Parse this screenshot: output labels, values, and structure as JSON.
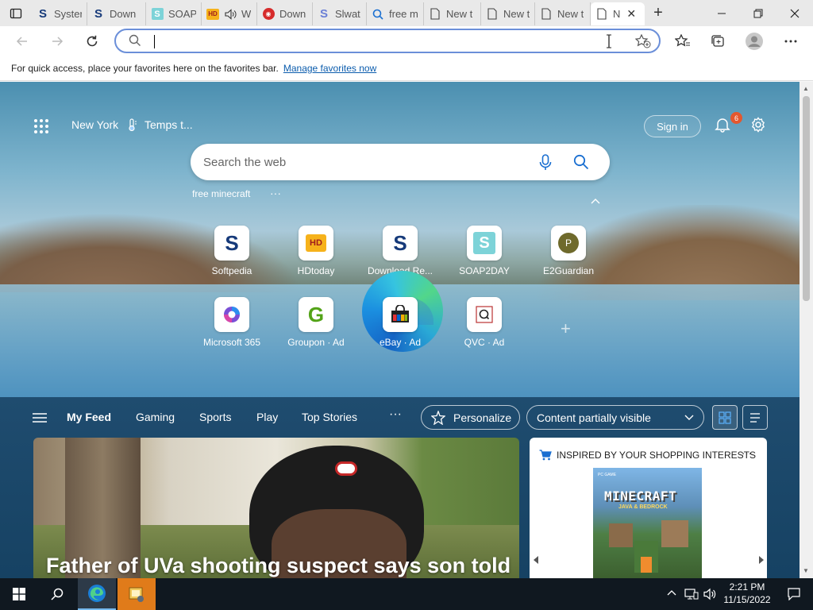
{
  "browser": {
    "tabs": [
      {
        "title": "Syster",
        "icon": "softpedia-s-icon"
      },
      {
        "title": "Down",
        "icon": "softpedia-s-icon"
      },
      {
        "title": "SOAP",
        "icon": "soap2day-s-icon"
      },
      {
        "title": "W",
        "icon": "hdtoday-icon"
      },
      {
        "title": "Down",
        "icon": "red-shield-icon"
      },
      {
        "title": "Slwat",
        "icon": "s-circle-icon"
      },
      {
        "title": "free m",
        "icon": "search-icon"
      },
      {
        "title": "New t",
        "icon": "page-icon"
      },
      {
        "title": "New t",
        "icon": "page-icon"
      },
      {
        "title": "New t",
        "icon": "page-icon"
      },
      {
        "title": "N",
        "icon": "page-icon"
      }
    ],
    "address_value": "",
    "favorites_bar": {
      "message": "For quick access, place your favorites here on the favorites bar.",
      "link": "Manage favorites now"
    }
  },
  "newtab": {
    "location": "New York",
    "weather": "Temps t...",
    "sign_in": "Sign in",
    "notification_count": "6",
    "search_placeholder": "Search the web",
    "suggestion": "free minecraft",
    "tiles_row1": [
      {
        "label": "Softpedia",
        "icon": "softpedia-s-icon"
      },
      {
        "label": "HDtoday",
        "icon": "hdtoday-icon"
      },
      {
        "label": "Download Re...",
        "icon": "softpedia-s-icon"
      },
      {
        "label": "SOAP2DAY",
        "icon": "soap2day-s-icon"
      },
      {
        "label": "E2Guardian",
        "icon": "p-circle-icon"
      }
    ],
    "tiles_row2": [
      {
        "label": "Microsoft 365",
        "icon": "microsoft365-icon"
      },
      {
        "label": "Groupon · Ad",
        "icon": "groupon-g-icon"
      },
      {
        "label": "eBay · Ad",
        "icon": "ebay-bag-icon"
      },
      {
        "label": "QVC · Ad",
        "icon": "qvc-icon"
      }
    ],
    "feed_nav": [
      "My Feed",
      "Gaming",
      "Sports",
      "Play",
      "Top Stories"
    ],
    "personalize": "Personalize",
    "content_visibility": "Content partially visible",
    "news_headline": "Father of UVa shooting suspect says son told",
    "shopping_header": "INSPIRED BY YOUR SHOPPING INTERESTS",
    "minecraft_title": "MINECRAFT",
    "minecraft_subtitle": "JAVA & BEDROCK",
    "minecraft_platform": "PC GAME"
  },
  "taskbar": {
    "time": "2:21 PM",
    "date": "11/15/2022"
  },
  "colors": {
    "accent": "#0b5cad",
    "address_border": "#6b8fd9",
    "badge": "#e4572e"
  }
}
